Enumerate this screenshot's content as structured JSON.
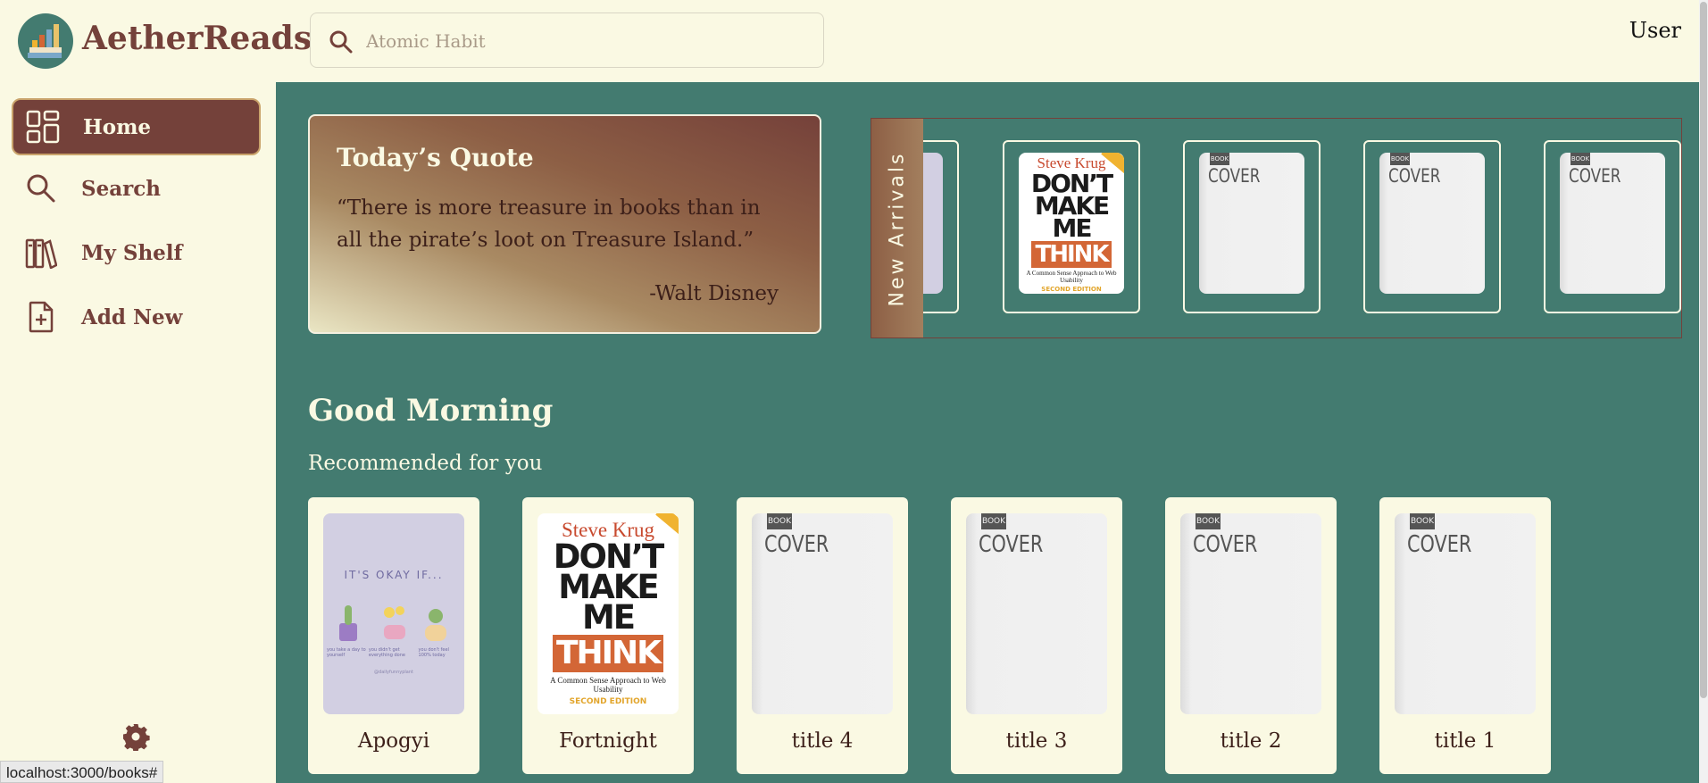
{
  "app": {
    "brand": "AetherReads",
    "user_label": "User"
  },
  "search": {
    "placeholder": "Atomic Habit"
  },
  "sidebar": {
    "items": [
      {
        "label": "Home",
        "icon": "dashboard-icon",
        "active": true
      },
      {
        "label": "Search",
        "icon": "search-icon",
        "active": false
      },
      {
        "label": "My Shelf",
        "icon": "books-icon",
        "active": false
      },
      {
        "label": "Add New",
        "icon": "add-file-icon",
        "active": false
      }
    ],
    "settings_icon": "gear-icon"
  },
  "quote": {
    "title": "Today’s Quote",
    "text": "“There is more treasure in books than in all the pirate’s loot on Treasure Island.”",
    "author": "-Walt Disney"
  },
  "new_arrivals": {
    "label": "New Arrivals",
    "covers": [
      "dont-make-me-think-cover",
      "book-cover-placeholder",
      "book-cover-placeholder",
      "book-cover-placeholder"
    ]
  },
  "greeting": "Good Morning",
  "recommended": {
    "label": "Recommended for you",
    "books": [
      {
        "title": "Apogyi",
        "cover": "its-okay-if-cover"
      },
      {
        "title": "Fortnight",
        "cover": "dont-make-me-think-cover"
      },
      {
        "title": "title 4",
        "cover": "book-cover-placeholder"
      },
      {
        "title": "title 3",
        "cover": "book-cover-placeholder"
      },
      {
        "title": "title 2",
        "cover": "book-cover-placeholder"
      },
      {
        "title": "title 1",
        "cover": "book-cover-placeholder"
      }
    ]
  },
  "covers": {
    "generic": {
      "badge": "BOOK",
      "text": "COVER"
    },
    "dmmt": {
      "author": "Steve Krug",
      "line1": "DON’T",
      "line2": "MAKE",
      "line3": "ME",
      "line4": "THINK",
      "subtitle": "A Common Sense Approach to Web Usability",
      "edition": "SECOND EDITION"
    },
    "okay": {
      "title": "IT'S OKAY IF...",
      "captions": [
        "you take a day to yourself",
        "you didn't get everything done",
        "you don't feel 100% today"
      ],
      "handle": "@dailyfunnyplant"
    }
  },
  "status_bar": {
    "url": "localhost:3000/books#"
  },
  "colors": {
    "brand": "#74413a",
    "main_bg": "#437b70",
    "cream": "#faf9e3",
    "accent_orange": "#d36636"
  }
}
